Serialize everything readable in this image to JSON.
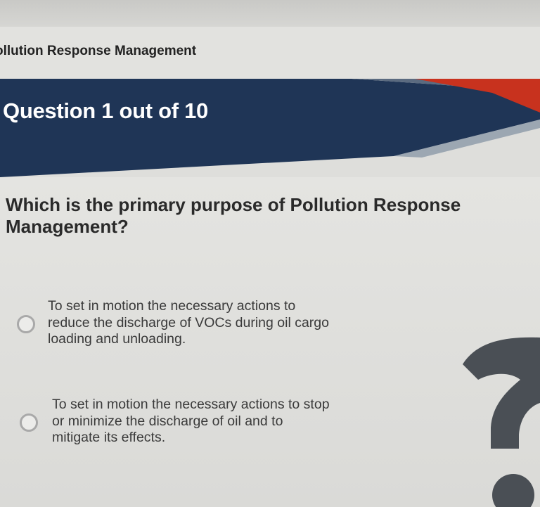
{
  "course": {
    "title": "ollution Response Management"
  },
  "quiz": {
    "progress_label": "Question 1 out of 10",
    "current": 1,
    "total": 10,
    "question": "Which is the primary purpose of Pollution Response Management?",
    "options": [
      {
        "label": "To set in motion the necessary actions to reduce the discharge of VOCs during oil cargo loading and unloading.",
        "selected": false
      },
      {
        "label": "To set in motion the necessary actions to stop or minimize the discharge of oil and to mitigate its effects.",
        "selected": false
      }
    ]
  },
  "colors": {
    "banner_navy": "#1f3556",
    "banner_accent_red": "#c8321e",
    "banner_stripe_gray": "#8b98a8",
    "decoration_dark_gray": "#4a4f55"
  },
  "icons": {
    "decoration": "question-mark-icon"
  }
}
